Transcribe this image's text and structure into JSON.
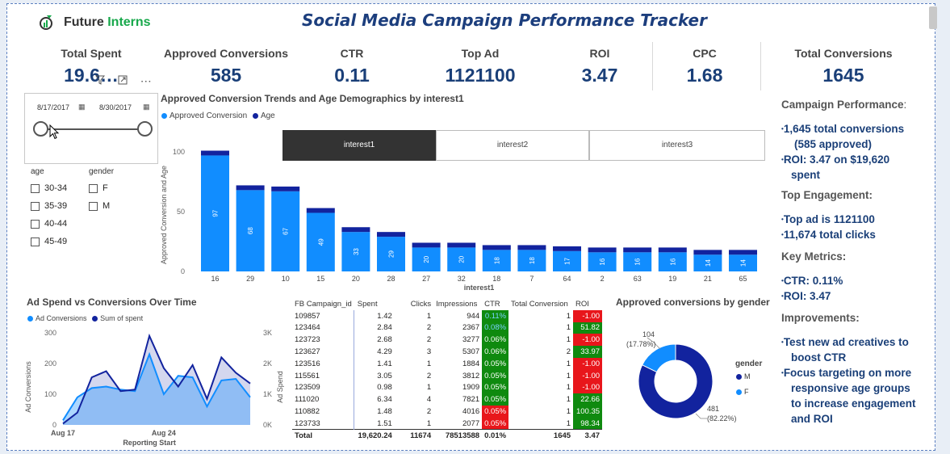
{
  "header": {
    "logo_prefix": "Future ",
    "logo_accent": "Interns",
    "title": "Social Media Campaign Performance Tracker"
  },
  "kpis": [
    {
      "label": "Total Spent",
      "value": "19.6…"
    },
    {
      "label": "Approved Conversions",
      "value": "585"
    },
    {
      "label": "CTR",
      "value": "0.11"
    },
    {
      "label": "Top Ad",
      "value": "1121100"
    },
    {
      "label": "ROI",
      "value": "3.47"
    },
    {
      "label": "CPC",
      "value": "1.68"
    },
    {
      "label": "Total Conversions",
      "value": "1645"
    }
  ],
  "date_slicer": {
    "start": "8/17/2017",
    "end": "8/30/2017"
  },
  "slicers": {
    "age_label": "age",
    "age_options": [
      "30-34",
      "35-39",
      "40-44",
      "45-49"
    ],
    "gender_label": "gender",
    "gender_options": [
      "F",
      "M"
    ]
  },
  "bar_chart": {
    "title": "Approved Conversion Trends and Age Demographics by interest1",
    "legend": [
      {
        "name": "Approved Conversion",
        "color": "#118dff"
      },
      {
        "name": "Age",
        "color": "#12239e"
      }
    ],
    "tabs": [
      "interest1",
      "interest2",
      "interest3"
    ],
    "active_tab": "interest1",
    "xlabel": "interest1",
    "ylabel": "Approved Conversion and Age",
    "y_ticks": [
      "100",
      "50",
      "0"
    ]
  },
  "line_chart": {
    "title": "Ad Spend vs Conversions Over Time",
    "legend": [
      {
        "name": "Ad Conversions",
        "color": "#118dff"
      },
      {
        "name": "Sum of spent",
        "color": "#12239e"
      }
    ],
    "xlabel": "Reporting Start",
    "ylabel_left": "Ad Conversions",
    "ylabel_right": "Ad Spend",
    "y_left_ticks": [
      "300",
      "200",
      "100",
      "0"
    ],
    "y_right_ticks": [
      "3K",
      "2K",
      "1K",
      "0K"
    ],
    "x_ticks": [
      "Aug 17",
      "Aug 24"
    ]
  },
  "table": {
    "headers": [
      "FB Campaign_id",
      "Spent",
      "Clicks",
      "Impressions",
      "CTR",
      "Total Conversion",
      "ROI"
    ],
    "rows": [
      {
        "id": "109857",
        "spent": "1.42",
        "clicks": "1",
        "impr": "944",
        "ctr": "0.11%",
        "conv": "1",
        "roi": "-1.00",
        "ctr_color": "#0f8a0f",
        "ctr_text": "#7ad1ff",
        "roi_color": "#e8161b"
      },
      {
        "id": "123464",
        "spent": "2.84",
        "clicks": "2",
        "impr": "2367",
        "ctr": "0.08%",
        "conv": "1",
        "roi": "51.82",
        "ctr_color": "#0f8a0f",
        "ctr_text": "#7ad1ff",
        "roi_color": "#0f8a0f"
      },
      {
        "id": "123723",
        "spent": "2.68",
        "clicks": "2",
        "impr": "3277",
        "ctr": "0.06%",
        "conv": "1",
        "roi": "-1.00",
        "ctr_color": "#0f8a0f",
        "ctr_text": "#ffffff",
        "roi_color": "#e8161b"
      },
      {
        "id": "123627",
        "spent": "4.29",
        "clicks": "3",
        "impr": "5307",
        "ctr": "0.06%",
        "conv": "2",
        "roi": "33.97",
        "ctr_color": "#0f8a0f",
        "ctr_text": "#ffffff",
        "roi_color": "#0f8a0f"
      },
      {
        "id": "123516",
        "spent": "1.41",
        "clicks": "1",
        "impr": "1884",
        "ctr": "0.05%",
        "conv": "1",
        "roi": "-1.00",
        "ctr_color": "#0f8a0f",
        "ctr_text": "#ffffff",
        "roi_color": "#e8161b"
      },
      {
        "id": "115561",
        "spent": "3.05",
        "clicks": "2",
        "impr": "3812",
        "ctr": "0.05%",
        "conv": "1",
        "roi": "-1.00",
        "ctr_color": "#0f8a0f",
        "ctr_text": "#ffffff",
        "roi_color": "#e8161b"
      },
      {
        "id": "123509",
        "spent": "0.98",
        "clicks": "1",
        "impr": "1909",
        "ctr": "0.05%",
        "conv": "1",
        "roi": "-1.00",
        "ctr_color": "#0f8a0f",
        "ctr_text": "#ffffff",
        "roi_color": "#e8161b"
      },
      {
        "id": "111020",
        "spent": "6.34",
        "clicks": "4",
        "impr": "7821",
        "ctr": "0.05%",
        "conv": "1",
        "roi": "22.66",
        "ctr_color": "#0f8a0f",
        "ctr_text": "#ffffff",
        "roi_color": "#0f8a0f"
      },
      {
        "id": "110882",
        "spent": "1.48",
        "clicks": "2",
        "impr": "4016",
        "ctr": "0.05%",
        "conv": "1",
        "roi": "100.35",
        "ctr_color": "#e8161b",
        "ctr_text": "#ffffff",
        "roi_color": "#0f8a0f"
      },
      {
        "id": "123733",
        "spent": "1.51",
        "clicks": "1",
        "impr": "2077",
        "ctr": "0.05%",
        "conv": "1",
        "roi": "98.34",
        "ctr_color": "#e8161b",
        "ctr_text": "#ffffff",
        "roi_color": "#0f8a0f"
      }
    ],
    "total": {
      "label": "Total",
      "spent": "19,620.24",
      "clicks": "11674",
      "impr": "78513588",
      "ctr": "0.01%",
      "conv": "1645",
      "roi": "3.47"
    }
  },
  "donut": {
    "title": "Approved conversions by gender",
    "legend_title": "gender",
    "legend": [
      {
        "name": "M",
        "color": "#12239e"
      },
      {
        "name": "F",
        "color": "#118dff"
      }
    ],
    "label_f_value": "104",
    "label_f_pct": "(17.78%)",
    "label_m_value": "481",
    "label_m_pct": "(82.22%)"
  },
  "right_panel": {
    "campaign_head": "Campaign Performance",
    "campaign_colon": ":",
    "campaign_items": [
      "1,645 total conversions",
      "(585 approved)",
      "ROI: 3.47 on $19,620",
      "spent"
    ],
    "engagement_head": "Top Engagement:",
    "engagement_items": [
      "Top ad is 1121100",
      "11,674 total clicks"
    ],
    "metrics_head": "Key Metrics:",
    "metrics_items": [
      "CTR: 0.11%",
      "ROI: 3.47"
    ],
    "improve_head": "Improvements:",
    "improve_items": [
      "Test new ad creatives to",
      "boost CTR",
      "Focus targeting on more",
      "responsive age groups",
      "to increase engagement",
      "and ROI"
    ]
  },
  "chart_data": [
    {
      "type": "bar",
      "title": "Approved Conversion Trends and Age Demographics by interest1",
      "xlabel": "interest1",
      "ylabel": "Approved Conversion and Age",
      "categories": [
        "16",
        "29",
        "10",
        "15",
        "20",
        "28",
        "27",
        "32",
        "18",
        "7",
        "64",
        "2",
        "63",
        "19",
        "21",
        "65"
      ],
      "series": [
        {
          "name": "Approved Conversion",
          "values": [
            97,
            68,
            67,
            49,
            33,
            29,
            20,
            20,
            18,
            18,
            17,
            16,
            16,
            16,
            14,
            14
          ]
        },
        {
          "name": "Age",
          "values": [
            4,
            4,
            4,
            4,
            4,
            4,
            4,
            4,
            4,
            4,
            4,
            4,
            4,
            4,
            4,
            4
          ]
        }
      ],
      "ylim": [
        0,
        100
      ],
      "legend": "top-left"
    },
    {
      "type": "area",
      "title": "Ad Spend vs Conversions Over Time",
      "xlabel": "Reporting Start",
      "x": [
        "Aug 17",
        "Aug 18",
        "Aug 19",
        "Aug 20",
        "Aug 21",
        "Aug 22",
        "Aug 23",
        "Aug 24",
        "Aug 25",
        "Aug 26",
        "Aug 27",
        "Aug 28",
        "Aug 29",
        "Aug 30"
      ],
      "series": [
        {
          "name": "Ad Conversions",
          "axis": "left",
          "values": [
            15,
            90,
            120,
            125,
            115,
            110,
            230,
            100,
            160,
            155,
            60,
            145,
            150,
            90
          ]
        },
        {
          "name": "Sum of spent",
          "axis": "right",
          "values": [
            40,
            400,
            1550,
            1750,
            1100,
            1150,
            2900,
            1850,
            1250,
            1950,
            850,
            2200,
            1700,
            1350
          ]
        }
      ],
      "ylim_left": [
        0,
        300
      ],
      "ylim_right": [
        0,
        3000
      ],
      "legend": "top-left"
    },
    {
      "type": "pie",
      "title": "Approved conversions by gender",
      "categories": [
        "M",
        "F"
      ],
      "values": [
        481,
        104
      ],
      "percent": [
        82.22,
        17.78
      ]
    }
  ]
}
